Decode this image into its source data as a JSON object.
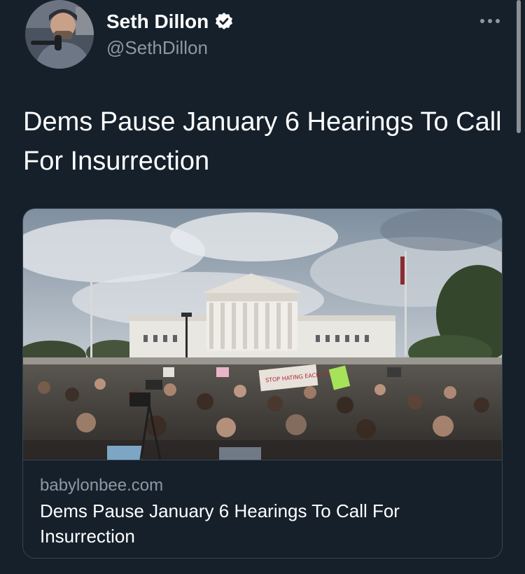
{
  "author": {
    "display_name": "Seth Dillon",
    "handle": "@SethDillon",
    "verified_icon": "verified-badge-icon"
  },
  "tweet": {
    "text": "Dems Pause January 6 Hearings To Call For Insurrection"
  },
  "link_card": {
    "domain": "babylonbee.com",
    "title": "Dems Pause January 6 Hearings To Call For Insurrection",
    "sign_text": "STOP HATING EACH OTHER"
  },
  "colors": {
    "background": "#15202b",
    "secondary_text": "#8b98a5",
    "border": "#38444d"
  },
  "icons": {
    "more": "more-options-icon"
  }
}
